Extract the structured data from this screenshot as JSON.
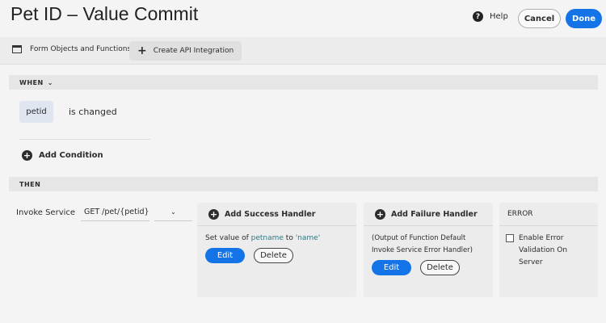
{
  "header": {
    "title": "Pet ID – Value Commit",
    "help_label": "Help",
    "cancel_label": "Cancel",
    "done_label": "Done"
  },
  "toolbar": {
    "form_objects_label": "Form Objects and Functions",
    "create_api_label": "Create API Integration"
  },
  "when": {
    "label": "WHEN",
    "field": "petid",
    "condition": "is changed",
    "add_condition_label": "Add Condition"
  },
  "then": {
    "label": "THEN",
    "action_label": "Invoke Service",
    "service": "GET /pet/{petid}",
    "success": {
      "title": "Add Success Handler",
      "text_prefix": "Set value of ",
      "field": "petname",
      "text_mid": " to ",
      "value": "'name'",
      "edit_label": "Edit",
      "delete_label": "Delete"
    },
    "failure": {
      "title": "Add Failure Handler",
      "text": "(Output of Function Default Invoke Service Error Handler)",
      "edit_label": "Edit",
      "delete_label": "Delete"
    },
    "error": {
      "title": "ERROR",
      "checkbox_label": "Enable Error Validation On Server"
    }
  }
}
